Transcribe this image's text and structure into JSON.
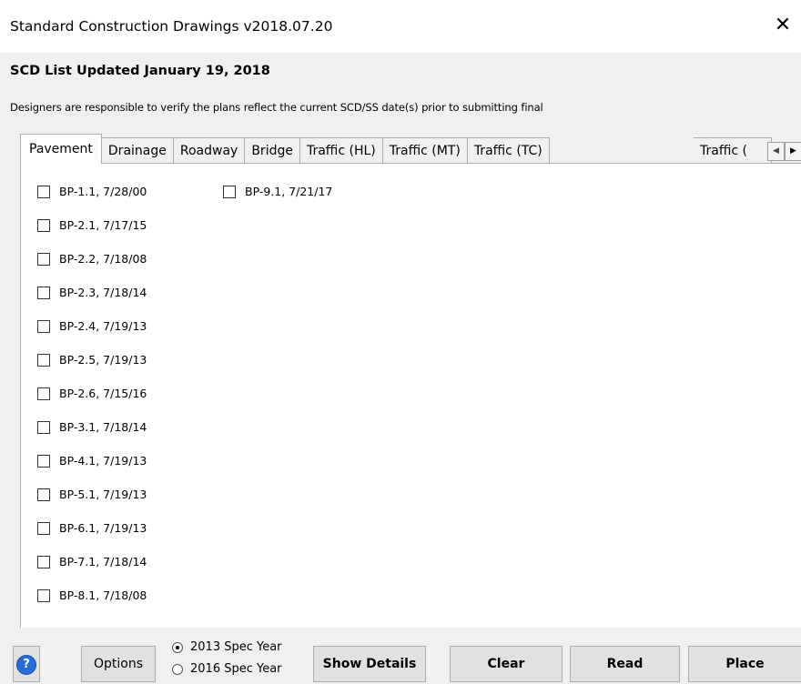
{
  "window": {
    "title": "Standard Construction Drawings v2018.07.20",
    "close_glyph": "✕"
  },
  "heading": "SCD List Updated January 19, 2018",
  "notice": "Designers are responsible to verify the plans reflect the current SCD/SS date(s) prior to submitting final",
  "tabs": [
    {
      "label": "Pavement",
      "active": true
    },
    {
      "label": "Drainage"
    },
    {
      "label": "Roadway"
    },
    {
      "label": "Bridge"
    },
    {
      "label": "Traffic (HL)"
    },
    {
      "label": "Traffic (MT)"
    },
    {
      "label": "Traffic (TC)"
    },
    {
      "label": "Traffic ("
    }
  ],
  "tab_scroll": {
    "left_icon": "◀",
    "right_icon": "▶"
  },
  "drawings_col1": [
    "BP-1.1, 7/28/00",
    "BP-2.1, 7/17/15",
    "BP-2.2, 7/18/08",
    "BP-2.3, 7/18/14",
    "BP-2.4, 7/19/13",
    "BP-2.5, 7/19/13",
    "BP-2.6, 7/15/16",
    "BP-3.1, 7/18/14",
    "BP-4.1, 7/19/13",
    "BP-5.1, 7/19/13",
    "BP-6.1, 7/19/13",
    "BP-7.1, 7/18/14",
    "BP-8.1, 7/18/08"
  ],
  "drawings_col2": [
    "BP-9.1, 7/21/17"
  ],
  "footer": {
    "help_glyph": "?",
    "options_label": "Options",
    "spec_2013": "2013 Spec Year",
    "spec_2016": "2016 Spec Year",
    "spec_selected": "2013 Spec Year",
    "show_details_label": "Show Details",
    "clear_label": "Clear",
    "read_label": "Read",
    "place_label": "Place"
  },
  "colors": {
    "help_icon": "#2a6cd6",
    "panel_bg": "#ffffff",
    "chrome_bg": "#f0f0f0"
  }
}
